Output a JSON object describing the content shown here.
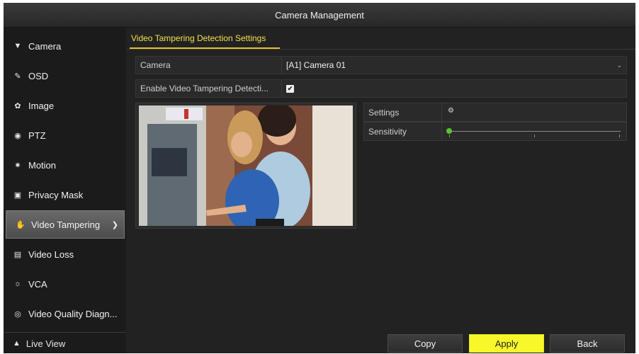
{
  "window": {
    "title": "Camera Management"
  },
  "sidebar": {
    "items": [
      {
        "label": "Camera",
        "icon": "camera-icon"
      },
      {
        "label": "OSD",
        "icon": "osd-icon"
      },
      {
        "label": "Image",
        "icon": "image-icon"
      },
      {
        "label": "PTZ",
        "icon": "ptz-icon"
      },
      {
        "label": "Motion",
        "icon": "motion-icon"
      },
      {
        "label": "Privacy Mask",
        "icon": "privacy-mask-icon"
      },
      {
        "label": "Video Tampering",
        "icon": "video-tampering-icon",
        "active": true
      },
      {
        "label": "Video Loss",
        "icon": "video-loss-icon"
      },
      {
        "label": "VCA",
        "icon": "vca-icon"
      },
      {
        "label": "Video Quality Diagn...",
        "icon": "video-quality-icon"
      }
    ],
    "footer": {
      "label": "Live View",
      "icon": "home-icon"
    }
  },
  "main": {
    "tab": "Video Tampering Detection Settings",
    "camera_label": "Camera",
    "camera_value": "[A1] Camera 01",
    "enable_label": "Enable Video Tampering Detecti...",
    "enable_checked": true,
    "settings_label": "Settings",
    "sensitivity_label": "Sensitivity",
    "sensitivity_level": 0
  },
  "buttons": {
    "copy": "Copy",
    "apply": "Apply",
    "back": "Back"
  },
  "colors": {
    "accent": "#f7f72a",
    "tab_text": "#f3e24a",
    "slider_knob": "#5bc236"
  }
}
